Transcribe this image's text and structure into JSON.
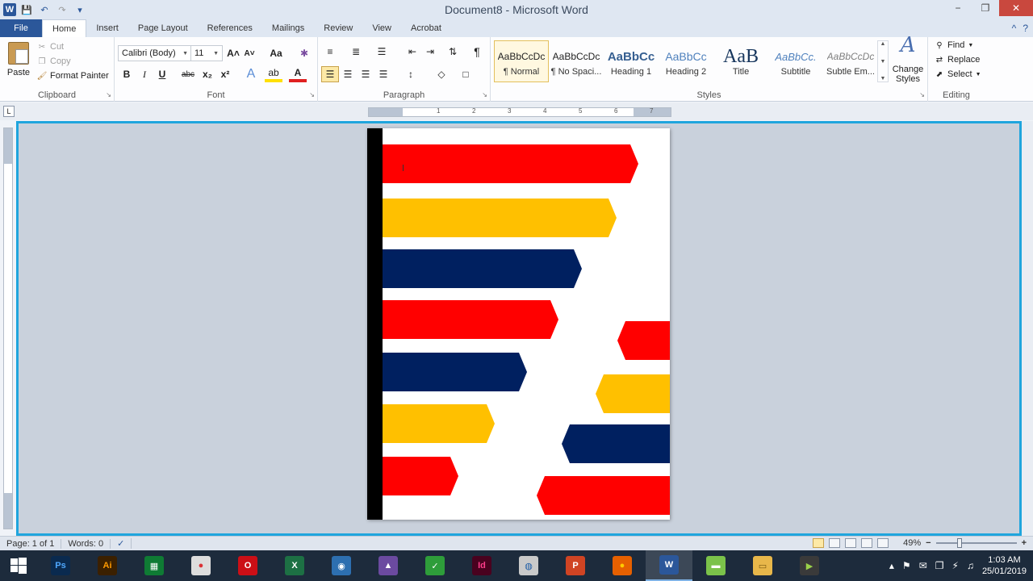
{
  "window": {
    "title_doc": "Document8",
    "title_sep": " - ",
    "title_app": "Microsoft Word",
    "controls": [
      "−",
      "❐",
      "✕"
    ]
  },
  "tabs": {
    "file": "File",
    "items": [
      "Home",
      "Insert",
      "Page Layout",
      "References",
      "Mailings",
      "Review",
      "View",
      "Acrobat"
    ],
    "right": [
      "^",
      "?"
    ]
  },
  "clipboard": {
    "paste": "Paste",
    "cut": "Cut",
    "copy": "Copy",
    "format_painter": "Format Painter",
    "label": "Clipboard"
  },
  "font": {
    "name": "Calibri (Body)",
    "size": "11",
    "grow": "A˄",
    "shrink": "A˅",
    "case": "Aa",
    "clear": "✱",
    "bold": "B",
    "italic": "I",
    "underline": "U",
    "strike": "abc",
    "sub": "x₂",
    "sup": "x²",
    "effects": "A",
    "highlight": "ab",
    "color": "A",
    "label": "Font",
    "accent_red": "#e02020",
    "accent_yellow": "#ffe000"
  },
  "paragraph": {
    "bullets": "≡",
    "numbering": "≣",
    "multilevel": "☰",
    "decrease": "⇤",
    "increase": "⇥",
    "sort": "⇅",
    "pilcrow": "¶",
    "align_left": "☰",
    "center": "☰",
    "align_right": "☰",
    "justify": "☰",
    "spacing": "↕",
    "shading": "◇",
    "borders": "□",
    "label": "Paragraph"
  },
  "styles": {
    "items": [
      {
        "preview": "AaBbCcDc",
        "name": "¶ Normal",
        "selected": true
      },
      {
        "preview": "AaBbCcDc",
        "name": "¶ No Spaci...",
        "selected": false
      },
      {
        "preview": "AaBbCc",
        "name": "Heading 1",
        "selected": false
      },
      {
        "preview": "AaBbCc",
        "name": "Heading 2",
        "selected": false
      },
      {
        "preview": "AaB",
        "name": "Title",
        "selected": false
      },
      {
        "preview": "AaBbCc.",
        "name": "Subtitle",
        "selected": false
      },
      {
        "preview": "AaBbCcDc",
        "name": "Subtle Em...",
        "selected": false
      }
    ],
    "change_line1": "Change",
    "change_line2": "Styles",
    "label": "Styles"
  },
  "editing": {
    "find": "Find",
    "replace": "Replace",
    "select": "Select",
    "label": "Editing"
  },
  "ruler": {
    "corner": "L",
    "numbers": [
      "1",
      "2",
      "3",
      "4",
      "5",
      "6",
      "7"
    ]
  },
  "document": {
    "colors": {
      "red": "#ff0000",
      "yellow": "#ffc000",
      "navy": "#002060",
      "bar": "#000000"
    }
  },
  "status": {
    "page": "Page: 1 of 1",
    "words": "Words: 0",
    "zoom": "49%",
    "zoom_out": "−",
    "zoom_in": "+"
  },
  "taskbar": {
    "apps": [
      {
        "name": "photoshop",
        "label": "Ps",
        "color": "#0a2a4f",
        "text": "#4fa8ff"
      },
      {
        "name": "illustrator",
        "label": "Ai",
        "color": "#3b2000",
        "text": "#ff9a00"
      },
      {
        "name": "store",
        "label": "▦",
        "color": "#0f7b34",
        "text": "#ffffff"
      },
      {
        "name": "chrome",
        "label": "●",
        "color": "#dddddd",
        "text": "#db3236"
      },
      {
        "name": "opera",
        "label": "O",
        "color": "#cc0f16",
        "text": "#ffffff"
      },
      {
        "name": "excel",
        "label": "X",
        "color": "#1d7044",
        "text": "#ffffff"
      },
      {
        "name": "camera",
        "label": "◉",
        "color": "#2d6fb0",
        "text": "#ffffff"
      },
      {
        "name": "photos",
        "label": "▲",
        "color": "#6b4aa0",
        "text": "#ffffff"
      },
      {
        "name": "green-app",
        "label": "✓",
        "color": "#2e9d3a",
        "text": "#ffffff"
      },
      {
        "name": "indesign",
        "label": "Id",
        "color": "#49021f",
        "text": "#ff3d8b"
      },
      {
        "name": "chat",
        "label": "◍",
        "color": "#c9c9c9",
        "text": "#1b5aa6"
      },
      {
        "name": "powerpoint",
        "label": "P",
        "color": "#d04423",
        "text": "#ffffff"
      },
      {
        "name": "firefox",
        "label": "●",
        "color": "#e66000",
        "text": "#ffcb00"
      },
      {
        "name": "word",
        "label": "W",
        "color": "#2b579a",
        "text": "#ffffff",
        "active": true
      },
      {
        "name": "green-box",
        "label": "▬",
        "color": "#7bc24a",
        "text": "#ffffff"
      },
      {
        "name": "explorer",
        "label": "▭",
        "color": "#e8b74a",
        "text": "#7a5a10"
      },
      {
        "name": "media",
        "label": "▶",
        "color": "#3a3a3a",
        "text": "#9ad14a"
      }
    ],
    "tray": [
      "▴",
      "⚑",
      "✉",
      "❐",
      "⚡",
      "♫"
    ],
    "time": "1:03 AM",
    "date": "25/01/2019"
  }
}
